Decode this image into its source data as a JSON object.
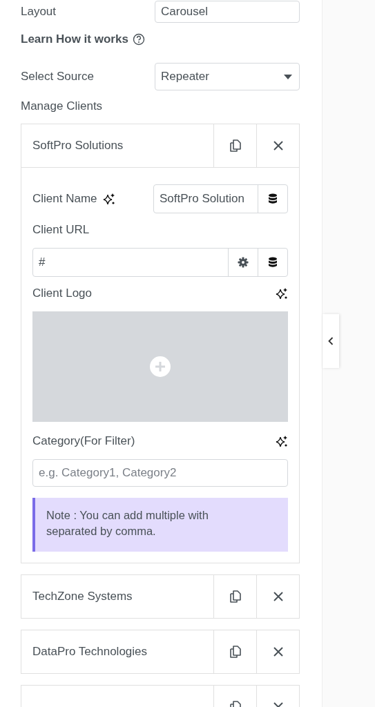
{
  "layout_field": {
    "label": "Layout",
    "value": "Carousel"
  },
  "help_link": {
    "label": "Learn How it works"
  },
  "source_field": {
    "label": "Select Source",
    "value": "Repeater"
  },
  "section_title": "Manage Clients",
  "clients": [
    {
      "name": "SoftPro Solutions",
      "expanded": true,
      "fields": [
        {
          "kind": "inline",
          "label": "Client Name",
          "value": "SoftPro Solution"
        },
        {
          "kind": "url",
          "label": "Client URL",
          "value": "#"
        },
        {
          "kind": "media",
          "label": "Client Logo"
        },
        {
          "kind": "text",
          "label": "Category(For Filter)",
          "placeholder": "e.g. Category1, Category2"
        }
      ],
      "note": "Note : You can add multiple with separated by comma."
    },
    {
      "name": "TechZone Systems",
      "expanded": false
    },
    {
      "name": "DataPro Technologies",
      "expanded": false
    },
    {
      "expanded": false
    }
  ]
}
